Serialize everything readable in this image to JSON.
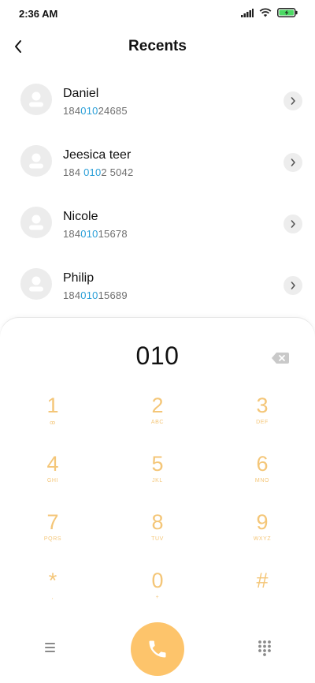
{
  "status_bar": {
    "time": "2:36 AM"
  },
  "header": {
    "title": "Recents"
  },
  "contacts": [
    {
      "name": "Daniel",
      "number_pre": "184",
      "number_match": "010",
      "number_post": "24685"
    },
    {
      "name": "Jeesica teer",
      "number_pre": "184 ",
      "number_match": "010",
      "number_post": "2 5042"
    },
    {
      "name": "Nicole",
      "number_pre": "184",
      "number_match": "010",
      "number_post": "15678"
    },
    {
      "name": "Philip",
      "number_pre": "184",
      "number_match": "010",
      "number_post": "15689"
    }
  ],
  "dialpad": {
    "display": "010",
    "keys": [
      {
        "digit": "1",
        "letters": "ꝏ"
      },
      {
        "digit": "2",
        "letters": "ABC"
      },
      {
        "digit": "3",
        "letters": "DEF"
      },
      {
        "digit": "4",
        "letters": "GHI"
      },
      {
        "digit": "5",
        "letters": "JKL"
      },
      {
        "digit": "6",
        "letters": "MNO"
      },
      {
        "digit": "7",
        "letters": "PQRS"
      },
      {
        "digit": "8",
        "letters": "TUV"
      },
      {
        "digit": "9",
        "letters": "WXYZ"
      },
      {
        "digit": "*",
        "letters": ","
      },
      {
        "digit": "0",
        "letters": "+"
      },
      {
        "digit": "#",
        "letters": ""
      }
    ]
  },
  "colors": {
    "accent": "#fdc46b",
    "key_text": "#f4c678",
    "match_highlight": "#2a9fd8",
    "battery": "#4cd964"
  }
}
